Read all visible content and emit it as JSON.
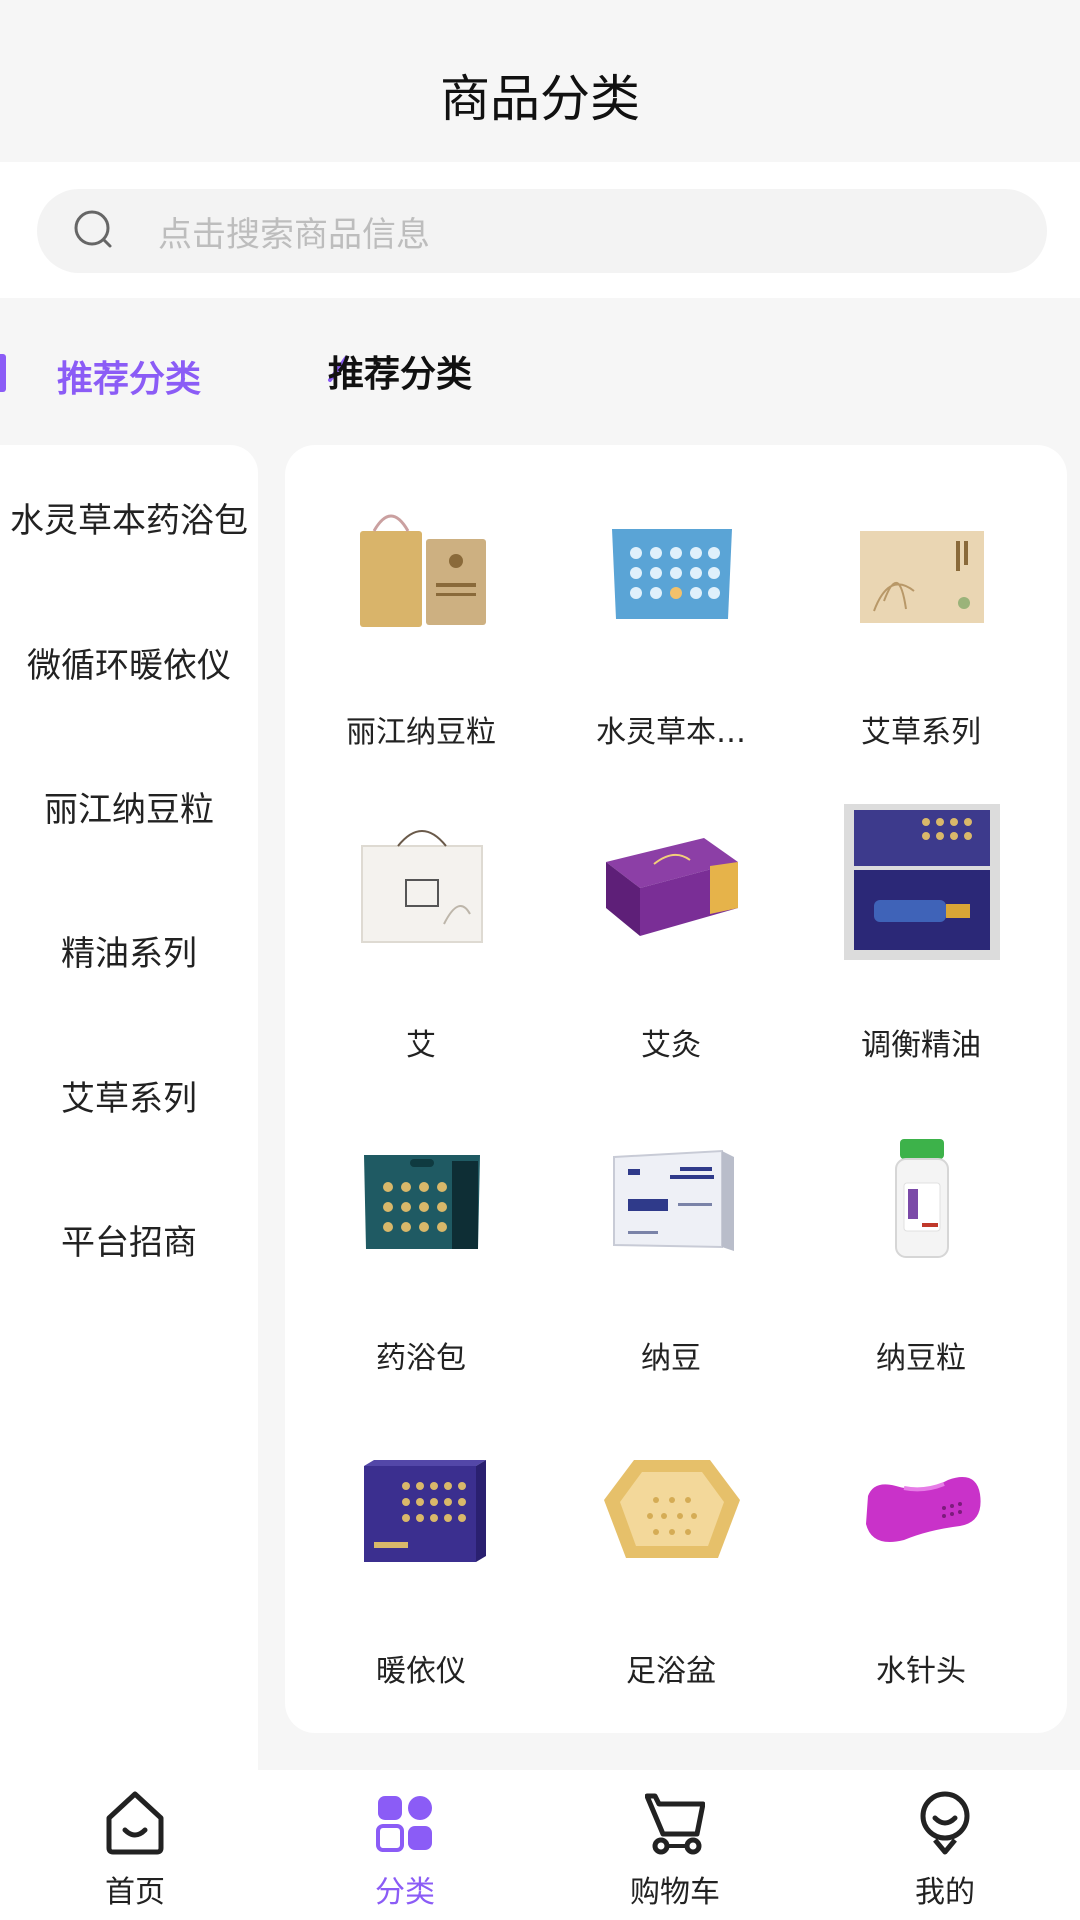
{
  "header": {
    "title": "商品分类"
  },
  "search": {
    "placeholder": "点击搜索商品信息",
    "icon": "search-icon"
  },
  "sidebar": {
    "active_label": "推荐分类",
    "items": [
      {
        "label": "水灵草本药浴包"
      },
      {
        "label": "微循环暖依仪"
      },
      {
        "label": "丽江纳豆粒"
      },
      {
        "label": "精油系列"
      },
      {
        "label": "艾草系列"
      },
      {
        "label": "平台招商"
      }
    ]
  },
  "section": {
    "title": "推荐分类"
  },
  "products": [
    {
      "name": "丽江纳豆粒",
      "icon": "gift-bag-box-image"
    },
    {
      "name": "水灵草本…",
      "icon": "blue-pouch-image"
    },
    {
      "name": "艾草系列",
      "icon": "beige-box-image"
    },
    {
      "name": "艾",
      "icon": "white-gift-bag-image"
    },
    {
      "name": "艾灸",
      "icon": "purple-box-image"
    },
    {
      "name": "调衡精油",
      "icon": "oil-bottle-case-image"
    },
    {
      "name": "药浴包",
      "icon": "teal-pouch-image"
    },
    {
      "name": "纳豆",
      "icon": "silver-box-image"
    },
    {
      "name": "纳豆粒",
      "icon": "supplement-bottle-image"
    },
    {
      "name": "暖依仪",
      "icon": "navy-box-image"
    },
    {
      "name": "足浴盆",
      "icon": "foot-basin-image"
    },
    {
      "name": "水针头",
      "icon": "pink-device-image"
    }
  ],
  "tabbar": {
    "items": [
      {
        "label": "首页",
        "icon": "home-icon"
      },
      {
        "label": "分类",
        "icon": "category-icon"
      },
      {
        "label": "购物车",
        "icon": "cart-icon"
      },
      {
        "label": "我的",
        "icon": "profile-icon"
      }
    ],
    "active_index": 1
  },
  "colors": {
    "accent": "#8b5cf6",
    "background": "#f6f6f6",
    "card": "#ffffff"
  }
}
